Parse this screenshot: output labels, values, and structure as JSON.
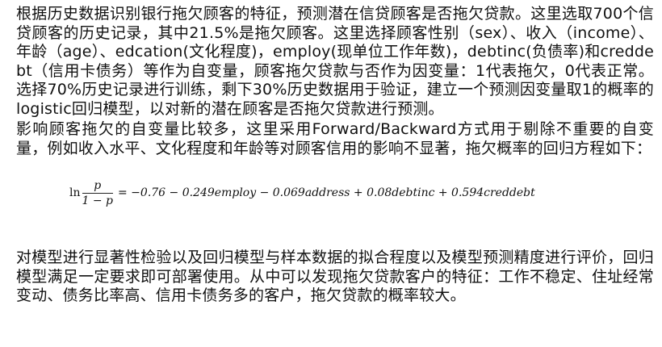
{
  "paragraphs": {
    "p1": "根据历史数据识别银行拖欠顾客的特征，预测潜在信贷顾客是否拖欠贷款。这里选取700个信贷顾客的历史记录，其中21.5%是拖欠顾客。这里选择顾客性别（sex）、收入（income）、年龄（age）、edcation(文化程度)，employ(现单位工作年数)，debtinc(负债率)和creddebt（信用卡债务）等作为自变量，顾客拖欠贷款与否作为因变量：1代表拖欠，0代表正常。选择70%历史记录进行训练，剩下30%历史数据用于验证，建立一个预测因变量取1的概率的logistic回归模型，以对新的潜在顾客是否拖欠贷款进行预测。",
    "p2": "影响顾客拖欠的自变量比较多，这里采用Forward/Backward方式用于剔除不重要的自变量，例如收入水平、文化程度和年龄等对顾客信用的影响不显著，拖欠概率的回归方程如下：",
    "p3": "对模型进行显著性检验以及回归模型与样本数据的拟合程度以及模型预测精度进行评价，回归模型满足一定要求即可部署使用。从中可以发现拖欠贷款客户的特征：工作不稳定、住址经常变动、债务比率高、信用卡债务多的客户，拖欠贷款的概率较大。"
  },
  "formula": {
    "ln": "ln",
    "numerator": "p",
    "denominator": "1 − p",
    "rhs": "= −0.76 − 0.249employ − 0.069address + 0.08debtinc + 0.594creddebt"
  }
}
